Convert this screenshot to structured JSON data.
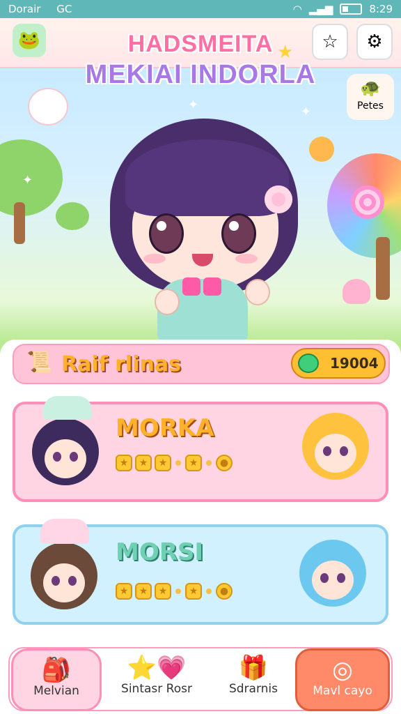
{
  "status_bar": {
    "left_text": "Dorair",
    "carrier": "GC",
    "time": "8:29"
  },
  "header": {
    "title_line1": "HADSMEITA",
    "title_line2": "MEKIAI INDORLA",
    "left_icon": "frog-balloon-icon",
    "right_icons": [
      "star-badge-icon",
      "settings-gear-icon"
    ]
  },
  "pets_chip": {
    "label": "Petes",
    "icon": "pet-face-icon"
  },
  "panel": {
    "title": "Raif rlinas",
    "coins": "19004",
    "cards": [
      {
        "name": "MORKA",
        "rating": 5,
        "name_color": "#ffb12b"
      },
      {
        "name": "MORSI",
        "rating": 5,
        "name_color": "#6fd0b2"
      }
    ]
  },
  "nav": {
    "tabs": [
      {
        "label": "Melvian",
        "icon": "backpack-icon",
        "active": true
      },
      {
        "label": "Sintasr Rosr",
        "icon": "star-heart-icon"
      },
      {
        "label": "Sdrarnis",
        "icon": "present-icon"
      },
      {
        "label": "Mavl cayo",
        "icon": "disc-icon"
      }
    ]
  },
  "colors": {
    "accent_pink": "#ff8fb6",
    "accent_teal": "#5fb8b7",
    "coin": "#ffbf33"
  }
}
